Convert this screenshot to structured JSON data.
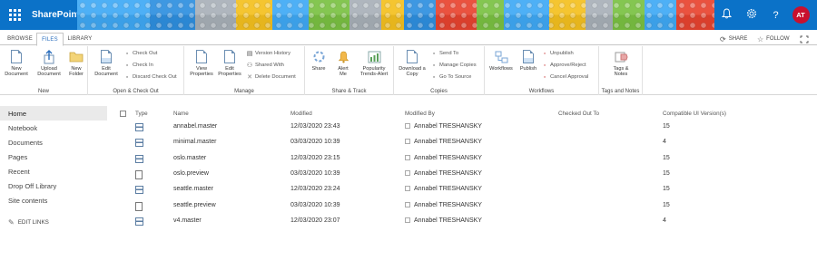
{
  "suite": {
    "brand": "SharePoint",
    "icons": [
      "waffle-icon",
      "bell-icon",
      "gear-icon",
      "help-icon"
    ],
    "avatar_initials": "AT",
    "avatar_color": "#c8102e"
  },
  "tabs": {
    "browse": "BROWSE",
    "files": "FILES",
    "library": "LIBRARY",
    "share": "SHARE",
    "follow": "FOLLOW"
  },
  "ribbon": {
    "new": {
      "label": "New",
      "new_document": "New\nDocument",
      "upload": "Upload\nDocument",
      "new_folder": "New\nFolder"
    },
    "open_checkout": {
      "label": "Open & Check Out",
      "edit_document": "Edit\nDocument",
      "check_out": "Check Out",
      "check_in": "Check In",
      "discard": "Discard Check Out"
    },
    "manage": {
      "label": "Manage",
      "view_properties": "View\nProperties",
      "edit_properties": "Edit\nProperties",
      "version_history": "Version History",
      "shared_with": "Shared With",
      "delete_document": "Delete Document"
    },
    "share_track": {
      "label": "Share & Track",
      "share": "Share",
      "alert_me": "Alert\nMe",
      "popularity": "Popularity\nTrends-Alert"
    },
    "copies": {
      "label": "Copies",
      "download": "Download a\nCopy",
      "send_to": "Send To",
      "manage_copies": "Manage Copies",
      "go_to_source": "Go To Source"
    },
    "workflows": {
      "label": "Workflows",
      "workflows": "Workflows",
      "publish": "Publish",
      "unpublish": "Unpublish",
      "approve_reject": "Approve/Reject",
      "cancel_approval": "Cancel Approval"
    },
    "tags": {
      "label": "Tags and Notes",
      "tags_notes": "Tags &\nNotes"
    }
  },
  "nav": {
    "items": [
      "Home",
      "Notebook",
      "Documents",
      "Pages",
      "Recent",
      "Drop Off Library",
      "Site contents"
    ],
    "edit_links": "EDIT LINKS"
  },
  "table": {
    "headers": {
      "type": "Type",
      "name": "Name",
      "modified": "Modified",
      "modified_by": "Modified By",
      "checked_out_to": "Checked Out To",
      "compat": "Compatible UI Version(s)"
    },
    "rows": [
      {
        "type": "master",
        "name": "annabel.master",
        "modified": "12/03/2020 23:43",
        "modified_by": "Annabel TRESHANSKY",
        "checked_out_to": "",
        "compat": "15"
      },
      {
        "type": "master",
        "name": "minimal.master",
        "modified": "03/03/2020 10:39",
        "modified_by": "Annabel TRESHANSKY",
        "checked_out_to": "",
        "compat": "4"
      },
      {
        "type": "master",
        "name": "oslo.master",
        "modified": "12/03/2020 23:15",
        "modified_by": "Annabel TRESHANSKY",
        "checked_out_to": "",
        "compat": "15"
      },
      {
        "type": "preview",
        "name": "oslo.preview",
        "modified": "03/03/2020 10:39",
        "modified_by": "Annabel TRESHANSKY",
        "checked_out_to": "",
        "compat": "15"
      },
      {
        "type": "master",
        "name": "seattle.master",
        "modified": "12/03/2020 23:24",
        "modified_by": "Annabel TRESHANSKY",
        "checked_out_to": "",
        "compat": "15"
      },
      {
        "type": "preview",
        "name": "seattle.preview",
        "modified": "03/03/2020 10:39",
        "modified_by": "Annabel TRESHANSKY",
        "checked_out_to": "",
        "compat": "15"
      },
      {
        "type": "master",
        "name": "v4.master",
        "modified": "12/03/2020 23:07",
        "modified_by": "Annabel TRESHANSKY",
        "checked_out_to": "",
        "compat": "4"
      }
    ]
  }
}
